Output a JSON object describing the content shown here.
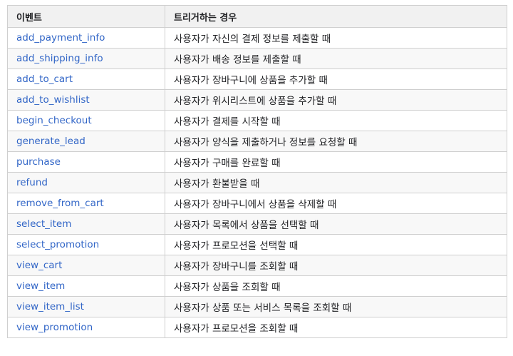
{
  "table": {
    "headers": [
      "이벤트",
      "트리거하는 경우"
    ],
    "rows": [
      {
        "event": "add_payment_info",
        "trigger": "사용자가 자신의 결제 정보를 제출할 때"
      },
      {
        "event": "add_shipping_info",
        "trigger": "사용자가 배송 정보를 제출할 때"
      },
      {
        "event": "add_to_cart",
        "trigger": "사용자가 장바구니에 상품을 추가할 때"
      },
      {
        "event": "add_to_wishlist",
        "trigger": "사용자가 위시리스트에 상품을 추가할 때"
      },
      {
        "event": "begin_checkout",
        "trigger": "사용자가 결제를 시작할 때"
      },
      {
        "event": "generate_lead",
        "trigger": "사용자가 양식을 제출하거나 정보를 요청할 때"
      },
      {
        "event": "purchase",
        "trigger": "사용자가 구매를 완료할 때"
      },
      {
        "event": "refund",
        "trigger": "사용자가 환불받을 때"
      },
      {
        "event": "remove_from_cart",
        "trigger": "사용자가 장바구니에서 상품을 삭제할 때"
      },
      {
        "event": "select_item",
        "trigger": "사용자가 목록에서 상품을 선택할 때"
      },
      {
        "event": "select_promotion",
        "trigger": "사용자가 프로모션을 선택할 때"
      },
      {
        "event": "view_cart",
        "trigger": "사용자가 장바구니를 조회할 때"
      },
      {
        "event": "view_item",
        "trigger": "사용자가 상품을 조회할 때"
      },
      {
        "event": "view_item_list",
        "trigger": "사용자가 상품 또는 서비스 목록을 조회할 때"
      },
      {
        "event": "view_promotion",
        "trigger": "사용자가 프로모션을 조회할 때"
      }
    ]
  },
  "colors": {
    "link": "#3266c7",
    "header_bg": "#f1f1f1",
    "alt_row_bg": "#f8f8f8",
    "border": "#cfcfcf"
  }
}
